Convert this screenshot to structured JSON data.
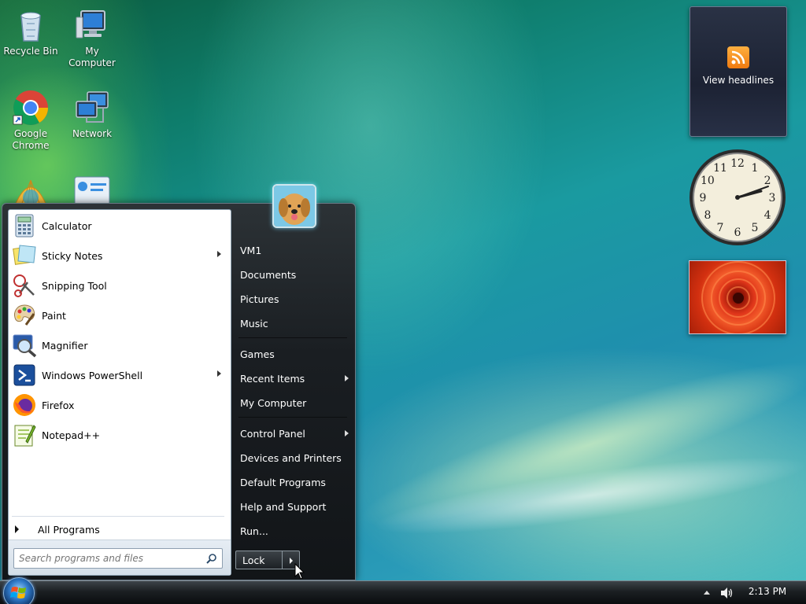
{
  "desktop": {
    "icons": [
      {
        "label": "Recycle Bin",
        "icon": "recycle-bin-icon"
      },
      {
        "label": "My Computer",
        "icon": "computer-icon"
      },
      {
        "label": "Google Chrome",
        "icon": "chrome-icon"
      },
      {
        "label": "Network",
        "icon": "network-icon"
      }
    ]
  },
  "gadgets": {
    "feed_label": "View headlines",
    "clock": {
      "numbers": [
        "12",
        "1",
        "2",
        "3",
        "4",
        "5",
        "6",
        "7",
        "8",
        "9",
        "10",
        "11"
      ],
      "time": "2:13"
    }
  },
  "start_menu": {
    "pinned": [
      {
        "label": "Calculator",
        "icon": "calculator-icon",
        "submenu": false
      },
      {
        "label": "Sticky Notes",
        "icon": "sticky-notes-icon",
        "submenu": true
      },
      {
        "label": "Snipping Tool",
        "icon": "scissors-icon",
        "submenu": false
      },
      {
        "label": "Paint",
        "icon": "paint-palette-icon",
        "submenu": false
      },
      {
        "label": "Magnifier",
        "icon": "magnifier-icon",
        "submenu": false
      },
      {
        "label": "Windows PowerShell",
        "icon": "powershell-icon",
        "submenu": true
      },
      {
        "label": "Firefox",
        "icon": "firefox-icon",
        "submenu": false
      },
      {
        "label": "Notepad++",
        "icon": "notepad-plus-plus-icon",
        "submenu": false
      }
    ],
    "all_programs": "All Programs",
    "search_placeholder": "Search programs and files",
    "right_items": [
      {
        "label": "VM1",
        "submenu": false
      },
      {
        "label": "Documents",
        "submenu": false
      },
      {
        "label": "Pictures",
        "submenu": false
      },
      {
        "label": "Music",
        "submenu": false
      },
      {
        "label": "Games",
        "submenu": false
      },
      {
        "label": "Recent Items",
        "submenu": true
      },
      {
        "label": "My Computer",
        "submenu": false
      },
      {
        "label": "Control Panel",
        "submenu": true
      },
      {
        "label": "Devices and Printers",
        "submenu": false
      },
      {
        "label": "Default Programs",
        "submenu": false
      },
      {
        "label": "Help and Support",
        "submenu": false
      },
      {
        "label": "Run...",
        "submenu": false
      }
    ],
    "lock_label": "Lock"
  },
  "taskbar": {
    "time": "2:13 PM"
  },
  "colors": {
    "accent": "#1f8fae",
    "menu_dark": "#1a1e22"
  }
}
